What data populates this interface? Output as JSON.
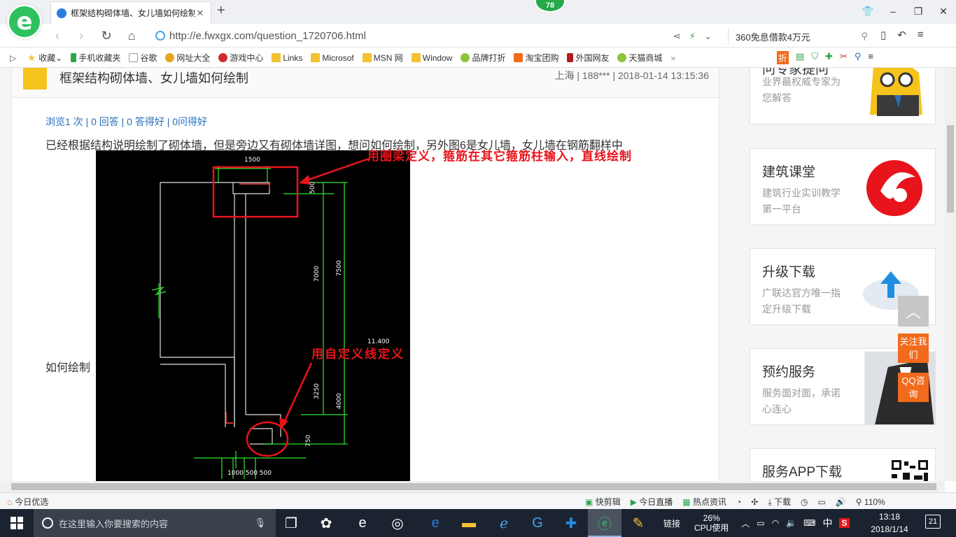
{
  "browser": {
    "tab_title": "框架结构砌体墙、女儿墙如何绘制",
    "badge_count": "78",
    "url": "http://e.fwxgx.com/question_1720706.html",
    "search_text": "360免息借款4万元"
  },
  "favorites": [
    {
      "label": "收藏",
      "icon": "star-icon"
    },
    {
      "label": "手机收藏夹",
      "icon": "phone-icon"
    },
    {
      "label": "谷歌",
      "icon": "page-icon"
    },
    {
      "label": "网址大全",
      "icon": "site-icon"
    },
    {
      "label": "游戏中心",
      "icon": "game-icon"
    },
    {
      "label": "Links",
      "icon": "folder-icon"
    },
    {
      "label": "Microsof",
      "icon": "folder-icon"
    },
    {
      "label": "MSN 网",
      "icon": "folder-icon"
    },
    {
      "label": "Window",
      "icon": "folder-icon"
    },
    {
      "label": "品牌打折",
      "icon": "leaf-icon"
    },
    {
      "label": "淘宝团购",
      "icon": "taobao-icon"
    },
    {
      "label": "外国网友",
      "icon": "flag-icon"
    },
    {
      "label": "天猫商城",
      "icon": "leaf-icon"
    }
  ],
  "question": {
    "title": "框架结构砌体墙、女儿墙如何绘制",
    "meta": "上海 | 188*** | 2018-01-14 13:15:36",
    "stats": "浏览1 次 | 0 回答 | 0 答得好 | 0问得好",
    "body": "已经根据结构说明绘制了砌体墙，但是旁边又有砌体墙详图，想问如何绘制，另外图6是女儿墙，女儿墙在钢筋翻样中",
    "howto": "如何绘制",
    "annotation_1": "用圈梁定义，箍筋在其它箍筋柱输入，直线绘制",
    "annotation_2": "用自定义线定义"
  },
  "cad": {
    "dim_top": "1500",
    "dim_500": "500",
    "dim_7000": "7000",
    "dim_7500": "7500",
    "dim_11400": "11.400",
    "dim_3250": "3250",
    "dim_4000": "4000",
    "dim_750": "750",
    "dim_bottom": "1000  500 500"
  },
  "sidebar": {
    "expert": {
      "title": "问专家提问",
      "subtitle": "业界最权威专家为您解答"
    },
    "classroom": {
      "title": "建筑课堂",
      "subtitle": "建筑行业实训教学第一平台"
    },
    "upgrade": {
      "title": "升级下载",
      "subtitle": "广联达官方唯一指定升级下载"
    },
    "service": {
      "title": "预约服务",
      "subtitle": "服务面对面，承诺心连心"
    },
    "app": {
      "title": "服务APP下载"
    }
  },
  "floating": {
    "follow": "关注我们",
    "qq": "QQ咨询"
  },
  "statusbar": {
    "today": "今日优选",
    "items": [
      "快剪辑",
      "今日直播",
      "热点资讯",
      "下载"
    ],
    "zoom": "110%"
  },
  "taskbar": {
    "search_placeholder": "在这里输入你要搜索的内容",
    "link": "链接",
    "cpu_pct": "26%",
    "cpu_label": "CPU使用",
    "ime": "中",
    "time": "13:18",
    "date": "2018/1/14",
    "notif_count": "21"
  },
  "colors": {
    "accent_red": "#e8141c",
    "cad_green": "#2fe82f",
    "orange": "#f26a1b",
    "link_blue": "#2a6fb8"
  }
}
